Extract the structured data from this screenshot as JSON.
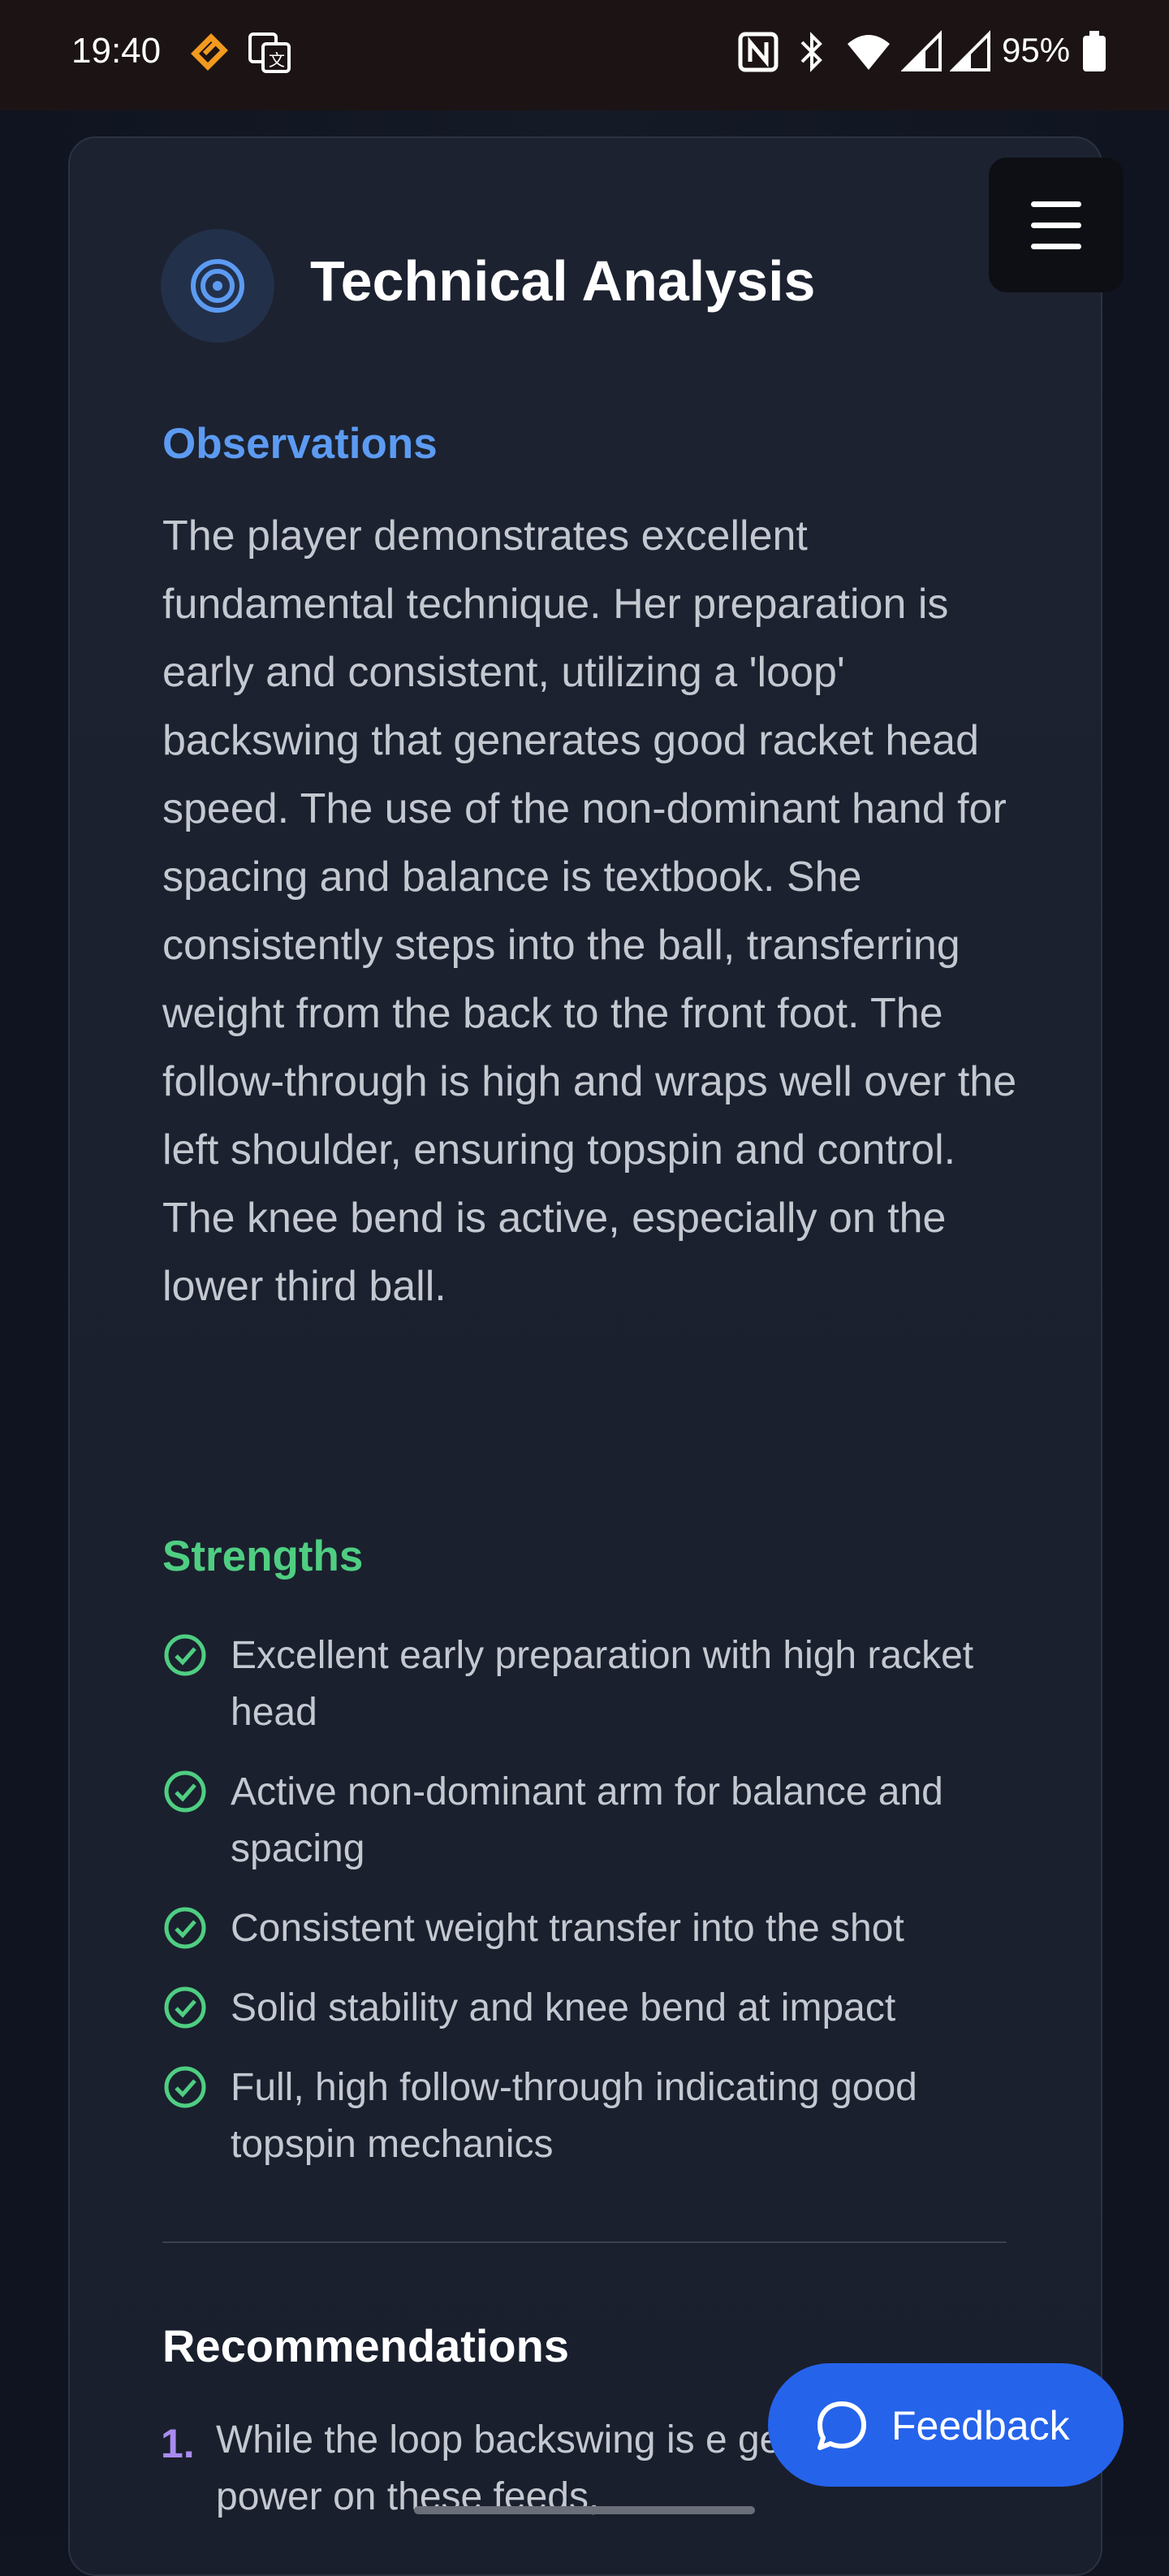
{
  "status_bar": {
    "time": "19:40",
    "battery": "95%",
    "icons": [
      "app-notification-icon",
      "translate-icon",
      "nfc-icon",
      "bluetooth-icon",
      "wifi-icon",
      "signal-icon",
      "signal-icon",
      "battery-icon"
    ]
  },
  "card": {
    "title": "Technical Analysis",
    "title_icon": "target-icon",
    "observations": {
      "heading": "Observations",
      "text": "The player demonstrates excellent fundamental technique. Her preparation is early and consistent, utilizing a 'loop' backswing that generates good racket head speed. The use of the non-dominant hand for spacing and balance is textbook. She consistently steps into the ball, transferring weight from the back to the front foot. The follow-through is high and wraps well over the left shoulder, ensuring topspin and control. The knee bend is active, especially on the lower third ball."
    },
    "strengths": {
      "heading": "Strengths",
      "items": [
        "Excellent early preparation with high racket head",
        "Active non-dominant arm for balance and spacing",
        "Consistent weight transfer into the shot",
        "Solid stability and knee bend at impact",
        "Full, high follow-through indicating good topspin mechanics"
      ]
    },
    "recommendations": {
      "heading": "Recommendations",
      "items": [
        {
          "number": "1.",
          "text": "While the loop backswing is e generating power on these feeds,"
        }
      ]
    }
  },
  "feedback_button": {
    "label": "Feedback"
  },
  "colors": {
    "accent_blue": "#5c9bf2",
    "strength_green": "#4fce82",
    "recommend_purple": "#a98cf0",
    "button_blue": "#2563eb"
  }
}
